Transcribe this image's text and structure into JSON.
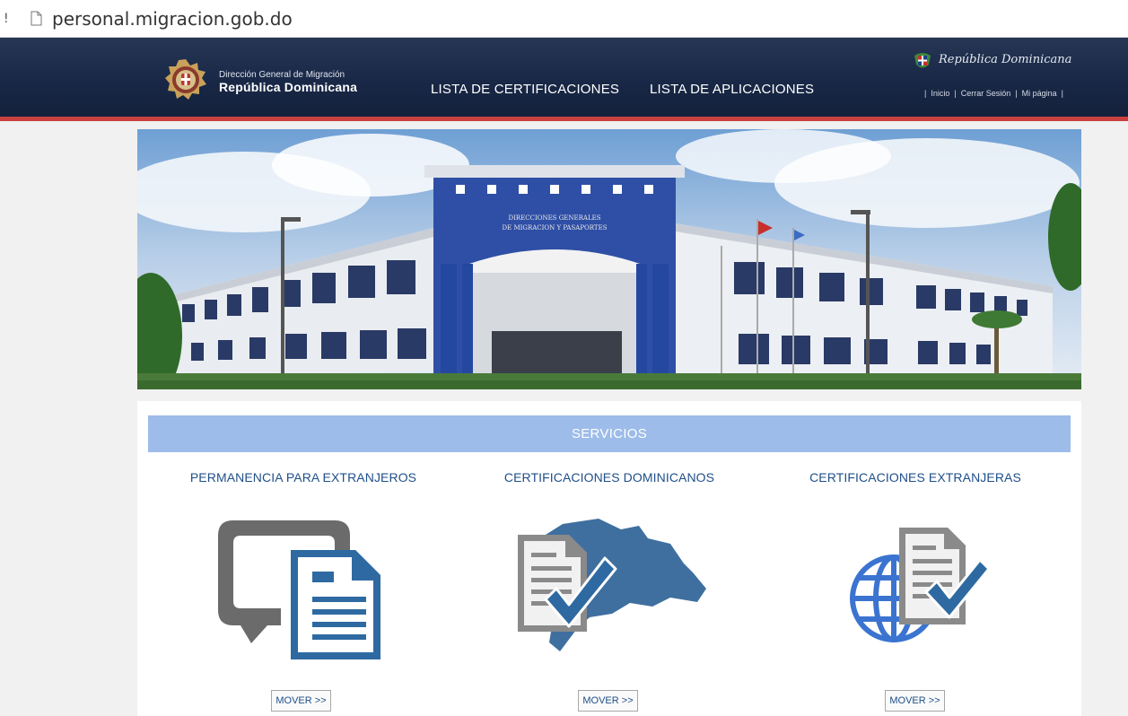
{
  "browser": {
    "url": "personal.migracion.gob.do"
  },
  "header": {
    "logo_line1": "Dirección General de Migración",
    "logo_line2": "República Dominicana",
    "nav": [
      {
        "label": "LISTA DE CERTIFICACIONES"
      },
      {
        "label": "LISTA DE APLICACIONES"
      }
    ],
    "republic_script": "República Dominicana",
    "util_links": [
      {
        "label": "Inicio"
      },
      {
        "label": "Cerrar Sesión"
      },
      {
        "label": "Mi página"
      }
    ]
  },
  "banner": {
    "building_sign_line1": "DIRECCIONES GENERALES",
    "building_sign_line2": "DE MIGRACION Y PASAPORTES"
  },
  "services": {
    "heading": "SERVICIOS",
    "items": [
      {
        "title": "PERMANENCIA PARA EXTRANJEROS",
        "button": "MOVER >>",
        "icon": "monitor-document-icon"
      },
      {
        "title": "CERTIFICACIONES DOMINICANOS",
        "button": "MOVER >>",
        "icon": "map-certificate-icon"
      },
      {
        "title": "CERTIFICACIONES EXTRANJERAS",
        "button": "MOVER >>",
        "icon": "globe-certificate-icon"
      }
    ]
  },
  "colors": {
    "header_bg": "#182745",
    "header_stripe": "#c9403f",
    "services_bar": "#9dbcea",
    "accent_blue": "#2e6aa1",
    "icon_gray": "#6b6b6b",
    "title_text": "#1f4f89"
  }
}
